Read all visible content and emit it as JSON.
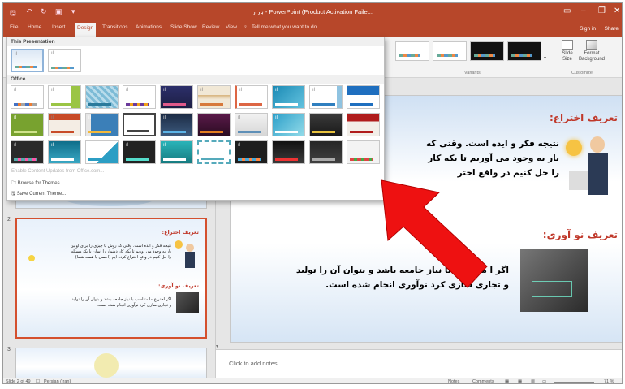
{
  "titlebar": {
    "doc_title": "بازار - PowerPoint (Product Activation Faile...",
    "qat_icons": [
      "save-icon",
      "undo-icon",
      "redo-icon",
      "present-icon",
      "customize-icon"
    ],
    "controls": [
      "ribbon-display-options",
      "minimize",
      "restore",
      "close"
    ]
  },
  "tabs": [
    "File",
    "Home",
    "Insert",
    "Design",
    "Transitions",
    "Animations",
    "Slide Show",
    "Review",
    "View"
  ],
  "active_tab": "Design",
  "tell_me": "Tell me what you want to do...",
  "sign_in": "Sign in",
  "share": "Share",
  "ribbon": {
    "variants_label": "Variants",
    "customize_label": "Customize",
    "slide_size_label": "Slide Size",
    "slide_size_lines": [
      "Slide",
      "Size"
    ],
    "format_background_label": "Format Background",
    "format_background_lines": [
      "Format",
      "Background"
    ]
  },
  "gallery": {
    "this_presentation_header": "This Presentation",
    "office_header": "Office",
    "theme_placeholder": "ıl",
    "enable_updates": "Enable Content Updates from Office.com...",
    "browse_themes": "Browse for Themes...",
    "save_theme": "Save Current Theme..."
  },
  "slide_numbers": [
    "2",
    "3"
  ],
  "slide_panel": {
    "thumb2_heading1": "تعریف اختراع:",
    "thumb2_text1": [
      "نتیجه فکر و ایده است. وقتی که روش یا چیزی را برای اولین",
      "بار به وجود می آوریم تا بکه کار دشوار را آسان یا یک مسئله",
      "را حل کنیم در واقع اختراع کرده ایم (احسن یا همت شما)"
    ],
    "thumb2_heading2": "تعریف نو آوری:",
    "thumb2_text2": [
      "اگر اختراع ما متناسب با نیاز جامعه باشد و بتوان آن را تولید",
      "و تجاری سازی کرد نوآوری انجام شده است."
    ]
  },
  "slide": {
    "heading1": "تعریف اختراع:",
    "body1": [
      "نتیجه فکر و ایده است. وقتی که",
      "بار به وجود می آوریم تا بکه کار",
      "را حل کنیم در واقع اختر"
    ],
    "heading2": "تعریف نو آوری:",
    "body2": [
      "اگر ا      متناسب با نیاز جامعه باشد و بتوان آن را تولید",
      "و تجاری سازی کرد نوآوری انجام شده است."
    ]
  },
  "notes_placeholder": "Click to add notes",
  "statusbar": {
    "slide_count": "Slide 2 of 49",
    "language": "Persian (Iran)",
    "notes": "Notes",
    "comments": "Comments",
    "zoom": "71 %"
  },
  "colors": {
    "brand": "#b7472a",
    "arrow": "#ee1111",
    "heading": "#c0392b"
  }
}
